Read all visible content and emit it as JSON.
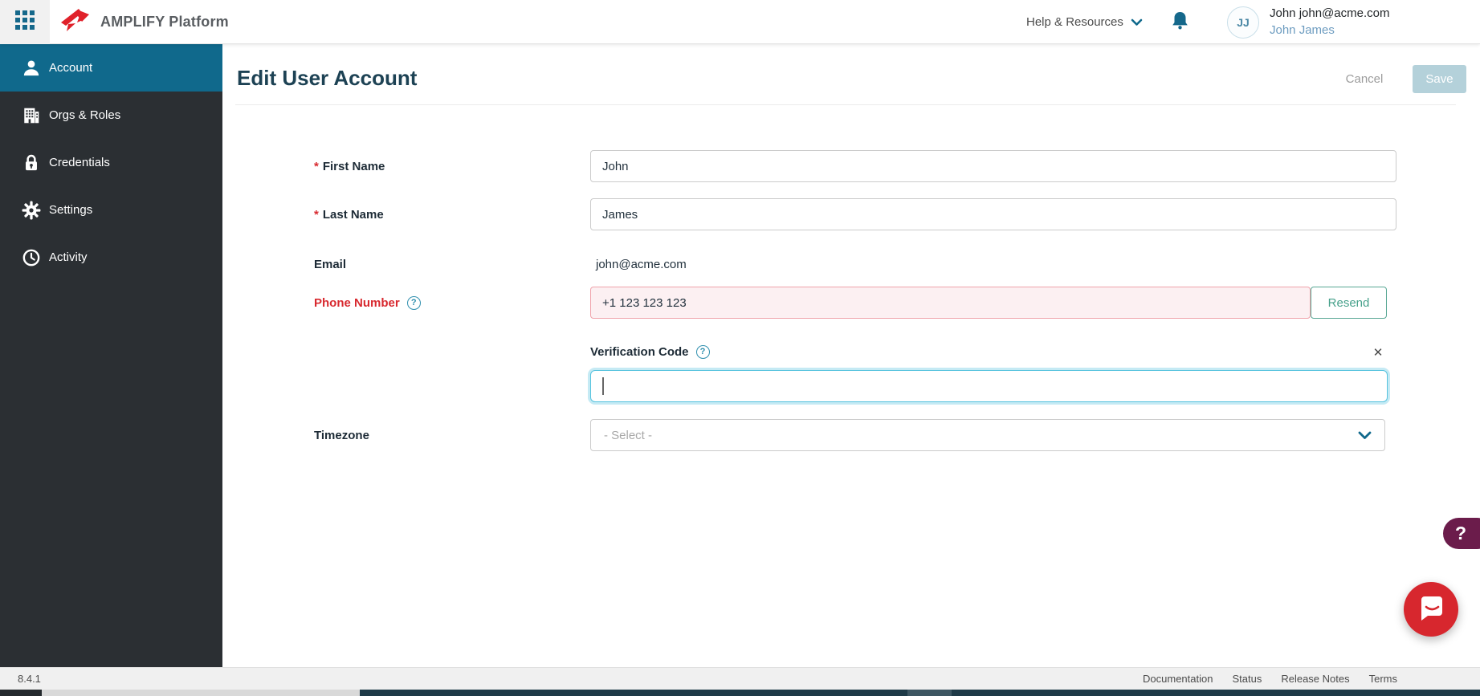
{
  "topbar": {
    "brand": "AMPLIFY Platform",
    "help_menu": "Help & Resources",
    "avatar_initials": "JJ",
    "user_primary": "John john@acme.com",
    "user_secondary": "John James"
  },
  "sidebar": {
    "items": [
      {
        "label": "Account",
        "icon": "user-icon",
        "active": true
      },
      {
        "label": "Orgs & Roles",
        "icon": "building-icon",
        "active": false
      },
      {
        "label": "Credentials",
        "icon": "lock-icon",
        "active": false
      },
      {
        "label": "Settings",
        "icon": "gear-icon",
        "active": false
      },
      {
        "label": "Activity",
        "icon": "clock-icon",
        "active": false
      }
    ]
  },
  "page": {
    "title": "Edit User Account",
    "cancel_label": "Cancel",
    "save_label": "Save"
  },
  "form": {
    "required_marker": "*",
    "first_name": {
      "label": "First Name",
      "value": "John"
    },
    "last_name": {
      "label": "Last Name",
      "value": "James"
    },
    "email": {
      "label": "Email",
      "value": "john@acme.com"
    },
    "phone": {
      "label": "Phone Number",
      "value": "+1 123 123 123",
      "resend_label": "Resend",
      "error": true
    },
    "verification": {
      "label": "Verification Code",
      "value": ""
    },
    "timezone": {
      "label": "Timezone",
      "placeholder": "- Select -"
    }
  },
  "footer": {
    "version": "8.4.1",
    "links": [
      "Documentation",
      "Status",
      "Release Notes",
      "Terms"
    ]
  },
  "floating": {
    "help_label": "?"
  },
  "icons": {
    "close": "✕",
    "help": "?"
  },
  "colors": {
    "accent_teal": "#10698c",
    "sidebar_bg": "#2b2f33",
    "brand_red": "#e0212a",
    "error_red": "#d8292f",
    "error_bg": "#fcf0f2",
    "resend_green": "#47a18b",
    "save_disabled_bg": "#b4d1da",
    "focus_cyan": "#57c3de",
    "help_pill": "#6b1c4b",
    "chat_red": "#d7272e"
  }
}
